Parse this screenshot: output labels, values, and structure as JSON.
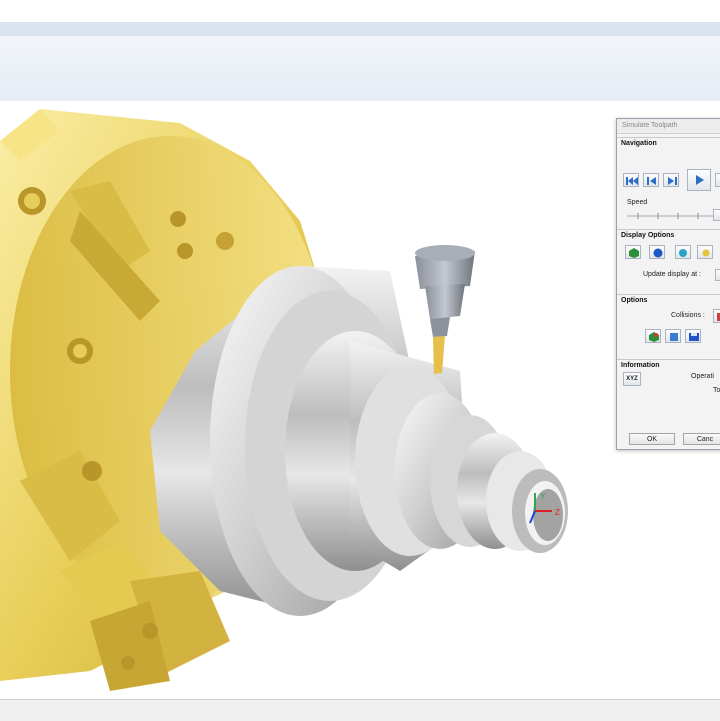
{
  "dialog": {
    "title": "Simulate Toolpath",
    "navigation_header": "Navigation",
    "speed_label": "Speed",
    "display_options_header": "Display Options",
    "update_display_label": "Update display at :",
    "options_header": "Options",
    "collisions_label": "Collisions :",
    "information_header": "Information",
    "xyz_button": "XYZ",
    "operation_label": "Operati",
    "to_label": "To",
    "ok_label": "OK",
    "cancel_label": "Canc"
  },
  "axes": {
    "x": "X",
    "y": "Y",
    "z": "Z"
  },
  "colors": {
    "chuck_gold": "#e8cf5a",
    "part_steel": "#c8c8c8",
    "ribbon": "#e5ecf4",
    "dialog_bg": "#f3f3f3"
  }
}
